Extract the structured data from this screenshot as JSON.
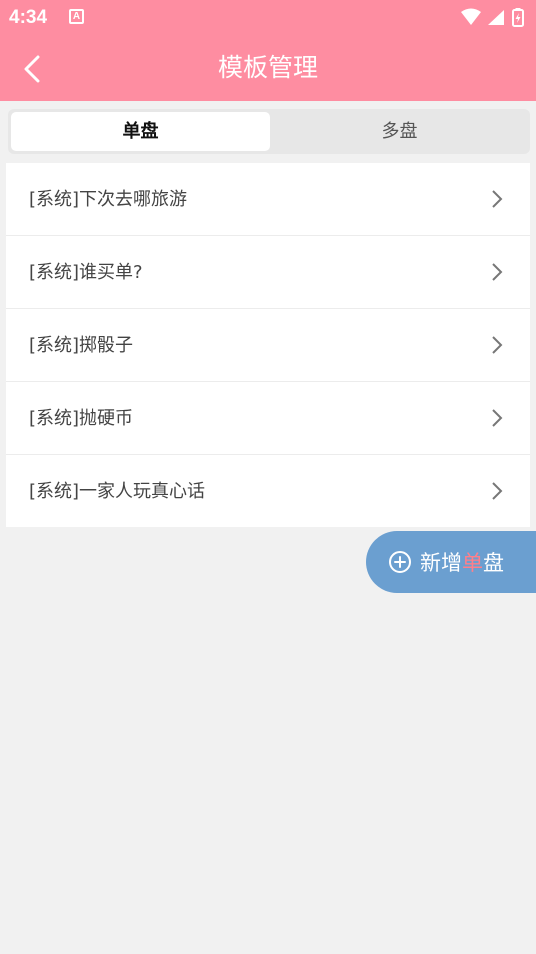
{
  "status_bar": {
    "time": "4:34",
    "notification_icon": "A"
  },
  "header": {
    "title": "模板管理"
  },
  "tabs": [
    {
      "label": "单盘",
      "selected": true
    },
    {
      "label": "多盘",
      "selected": false
    }
  ],
  "list": {
    "items": [
      {
        "label": "[系统]下次去哪旅游"
      },
      {
        "label": "[系统]谁买单?"
      },
      {
        "label": "[系统]掷骰子"
      },
      {
        "label": "[系统]抛硬币"
      },
      {
        "label": "[系统]一家人玩真心话"
      }
    ]
  },
  "fab": {
    "prefix": "新增",
    "accent": "单",
    "suffix": "盘"
  },
  "colors": {
    "header": "#fe8da1",
    "background": "#f1f1f1",
    "fab": "#6b9fd0",
    "fab_accent": "#ff7f8a"
  }
}
